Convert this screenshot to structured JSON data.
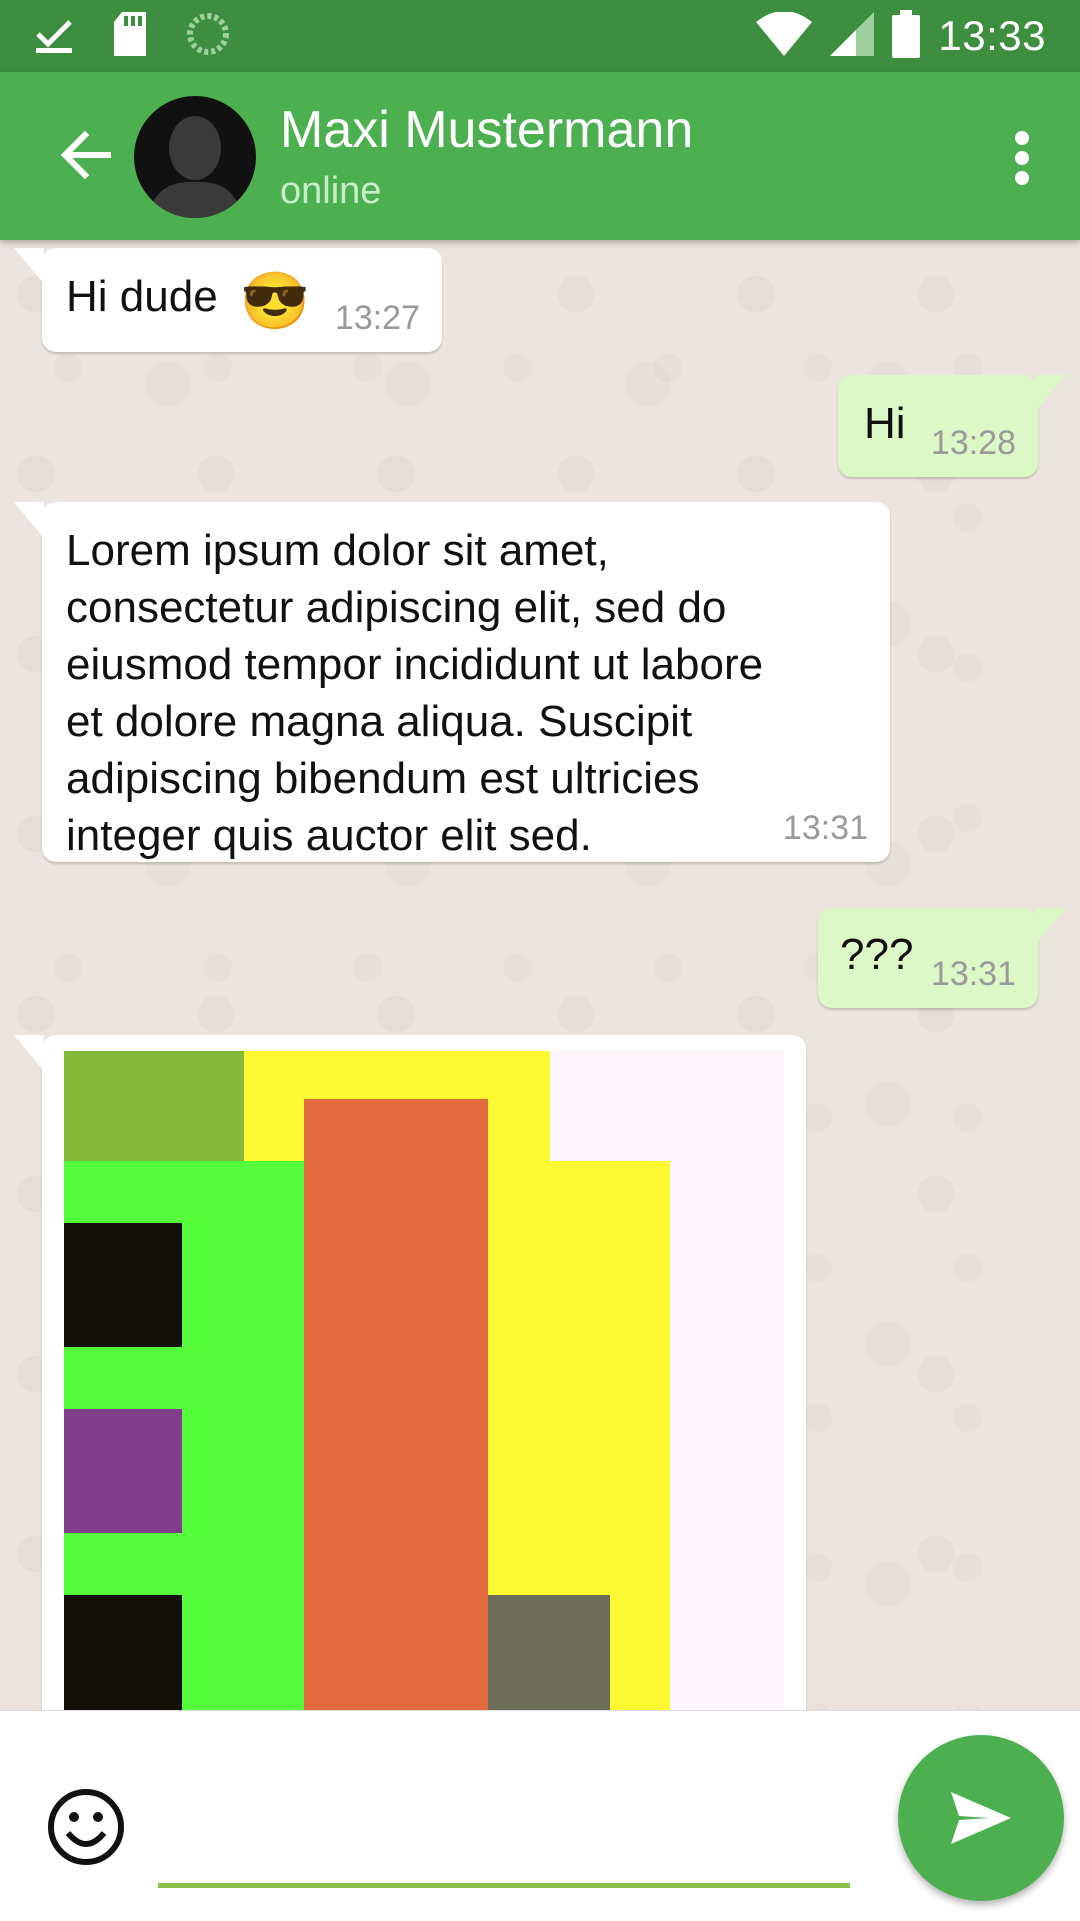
{
  "status_bar": {
    "time": "13:33",
    "left_icons": [
      "check-download-icon",
      "sd-card-icon",
      "sync-spinner-icon"
    ],
    "right_icons": [
      "wifi-icon",
      "cell-signal-icon",
      "battery-icon"
    ]
  },
  "header": {
    "contact_name": "Maxi Mustermann",
    "contact_status": "online",
    "accent_color": "#4caf50",
    "status_bar_color": "#3e8e3f"
  },
  "messages": [
    {
      "direction": "incoming",
      "text": "Hi dude",
      "emoji": "😎",
      "time": "13:27"
    },
    {
      "direction": "outgoing",
      "text": "Hi",
      "time": "13:28"
    },
    {
      "direction": "incoming",
      "text": "Lorem ipsum dolor sit amet,\nconsectetur adipiscing elit, sed do\neiusmod tempor incididunt ut labore\net dolore magna aliqua. Suscipit\nadipiscing bibendum est ultricies\ninteger quis auctor elit sed.",
      "time": "13:31"
    },
    {
      "direction": "outgoing",
      "text": "???",
      "time": "13:31"
    },
    {
      "direction": "incoming",
      "type": "image"
    }
  ],
  "input": {
    "placeholder": "",
    "value": ""
  }
}
